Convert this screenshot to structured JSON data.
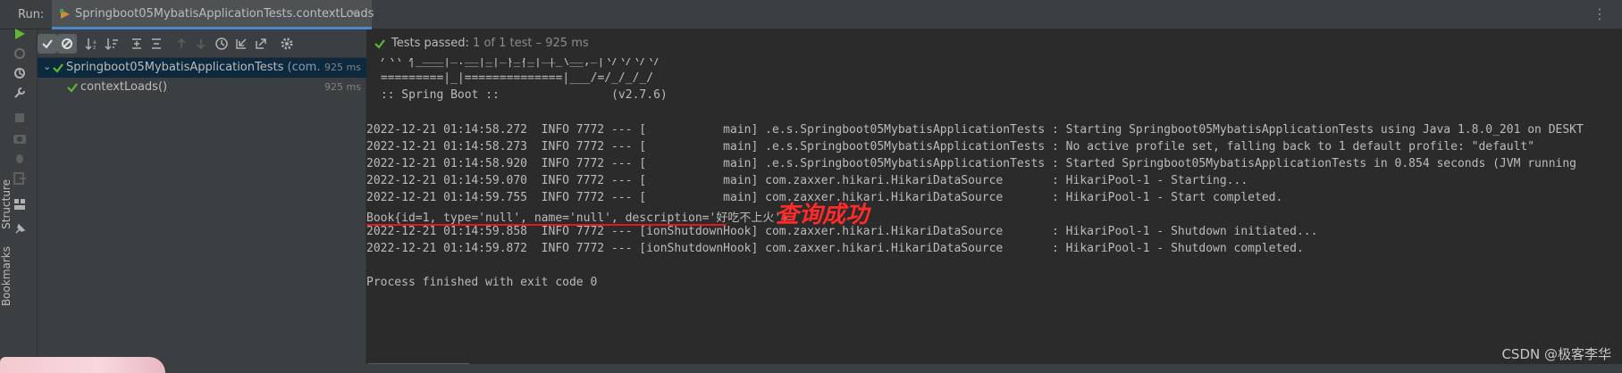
{
  "run_panel": {
    "label": "Run:",
    "tab_title": "Springboot05MybatisApplicationTests.contextLoads",
    "tab_close": "×"
  },
  "left_strip": {
    "vertical_tabs": [
      "Structure",
      "Bookmarks"
    ]
  },
  "test_toolbar": {
    "icons": [
      "run-icon",
      "check-filter-icon",
      "ignored-filter-icon",
      "sort-alpha-icon",
      "sort-duration-icon",
      "expand-all-icon",
      "collapse-all-icon",
      "previous-failed-icon",
      "next-failed-icon",
      "history-icon",
      "import-tests-icon",
      "export-tests-icon",
      "settings-icon"
    ]
  },
  "test_tree": {
    "root": {
      "name": "Springboot05MybatisApplicationTests",
      "package": " (com.exam",
      "duration": "925 ms"
    },
    "children": [
      {
        "name": "contextLoads()",
        "duration": "925 ms"
      }
    ]
  },
  "status": {
    "passed": "Tests passed: ",
    "detail": "1 of 1 test – 925 ms"
  },
  "console": {
    "ascii_lines": [
      "  '  |____| .__|_| |_|_| |_\\__, | / / / /",
      " =========|_|==============|___/=/_/_/_/",
      " :: Spring Boot ::                (v2.7.6)"
    ],
    "log_lines": [
      "2022-12-21 01:14:58.272  INFO 7772 --- [           main] .e.s.Springboot05MybatisApplicationTests : Starting Springboot05MybatisApplicationTests using Java 1.8.0_201 on DESKT",
      "2022-12-21 01:14:58.273  INFO 7772 --- [           main] .e.s.Springboot05MybatisApplicationTests : No active profile set, falling back to 1 default profile: \"default\"",
      "2022-12-21 01:14:58.920  INFO 7772 --- [           main] .e.s.Springboot05MybatisApplicationTests : Started Springboot05MybatisApplicationTests in 0.854 seconds (JVM running",
      "2022-12-21 01:14:59.070  INFO 7772 --- [           main] com.zaxxer.hikari.HikariDataSource       : HikariPool-1 - Starting...",
      "2022-12-21 01:14:59.755  INFO 7772 --- [           main] com.zaxxer.hikari.HikariDataSource       : HikariPool-1 - Start completed."
    ],
    "book_line": "Book{id=1, type='null', name='null', description='好吃不上火'}",
    "shutdown_lines": [
      "2022-12-21 01:14:59.858  INFO 7772 --- [ionShutdownHook] com.zaxxer.hikari.HikariDataSource       : HikariPool-1 - Shutdown initiated...",
      "2022-12-21 01:14:59.872  INFO 7772 --- [ionShutdownHook] com.zaxxer.hikari.HikariDataSource       : HikariPool-1 - Shutdown completed."
    ],
    "exit_line": "Process finished with exit code 0"
  },
  "annotation": "查询成功",
  "watermark": "CSDN @极客李华",
  "colors": {
    "pass_green": "#5fb832",
    "annotation_red": "#ff2a2a",
    "selection": "#0d293e"
  }
}
